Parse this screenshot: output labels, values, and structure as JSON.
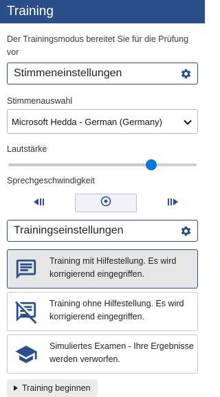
{
  "header": {
    "title": "Training"
  },
  "intro": {
    "text": "Der Trainingsmodus bereitet Sie für die Prüfung vor"
  },
  "voice_section": {
    "title": "Stimmeneinstellungen",
    "icon": "gear-icon"
  },
  "voice_select": {
    "label": "Stimmenauswahl",
    "value": "Microsoft Hedda - German (Germany)"
  },
  "volume": {
    "label": "Lautstärke",
    "level_percent": 76
  },
  "speed": {
    "label": "Sprechgeschwindigkeit",
    "buttons": [
      "slower-icon",
      "normal-speed-icon",
      "faster-icon"
    ]
  },
  "training_section": {
    "title": "Trainingseinstellungen",
    "icon": "gear-icon"
  },
  "modes": [
    {
      "text": "Training mit Hilfestellung. Es wird korrigierend eingegriffen.",
      "icon": "comment-icon",
      "selected": true
    },
    {
      "text": "Training ohne Hilfestellung. Es wird korrigierend eingegriffen.",
      "icon": "comment-off-icon",
      "selected": false
    },
    {
      "text": "Simuliertes Examen - Ihre Ergebnisse werden verworfen.",
      "icon": "graduation-cap-icon",
      "selected": false
    }
  ],
  "start_button": {
    "label": "Training beginnen"
  },
  "colors": {
    "header": "#2a4f8a",
    "accent": "#0a78d4",
    "selected": "#e6e6e6"
  }
}
